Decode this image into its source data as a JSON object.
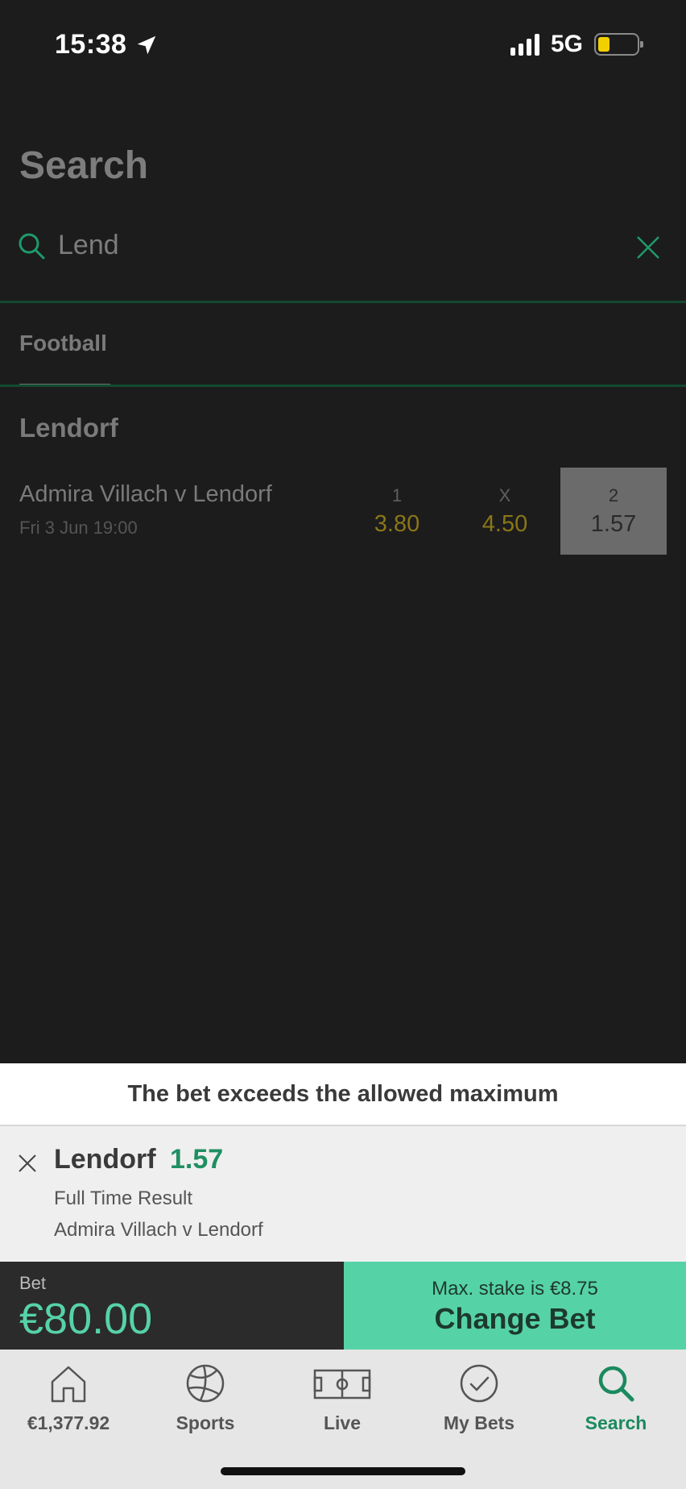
{
  "status_bar": {
    "time": "15:38",
    "network": "5G"
  },
  "search": {
    "title": "Search",
    "query": "Lend"
  },
  "tabs": [
    {
      "label": "Football"
    }
  ],
  "results": {
    "section_title": "Lendorf",
    "events": [
      {
        "name": "Admira Villach v Lendorf",
        "datetime": "Fri 3 Jun 19:00",
        "odds": [
          {
            "label": "1",
            "value": "3.80"
          },
          {
            "label": "X",
            "value": "4.50"
          },
          {
            "label": "2",
            "value": "1.57",
            "selected": true
          }
        ]
      }
    ]
  },
  "bet_slip": {
    "warning": "The bet exceeds the allowed maximum",
    "selection": {
      "name": "Lendorf",
      "odds": "1.57",
      "market": "Full Time Result",
      "event": "Admira Villach v Lendorf"
    },
    "stake_label": "Bet",
    "stake_value": "€80.00",
    "max_stake_text": "Max. stake is €8.75",
    "change_label": "Change Bet"
  },
  "bottom_nav": [
    {
      "label": "€1,377.92",
      "icon": "home-icon"
    },
    {
      "label": "Sports",
      "icon": "football-icon"
    },
    {
      "label": "Live",
      "icon": "pitch-icon"
    },
    {
      "label": "My Bets",
      "icon": "check-circle-icon"
    },
    {
      "label": "Search",
      "icon": "search-icon",
      "active": true
    }
  ],
  "colors": {
    "background": "#1c1c1c",
    "accent_green": "#56d2a7",
    "odds_text": "#8a7618",
    "active_nav": "#1b8a5e"
  }
}
